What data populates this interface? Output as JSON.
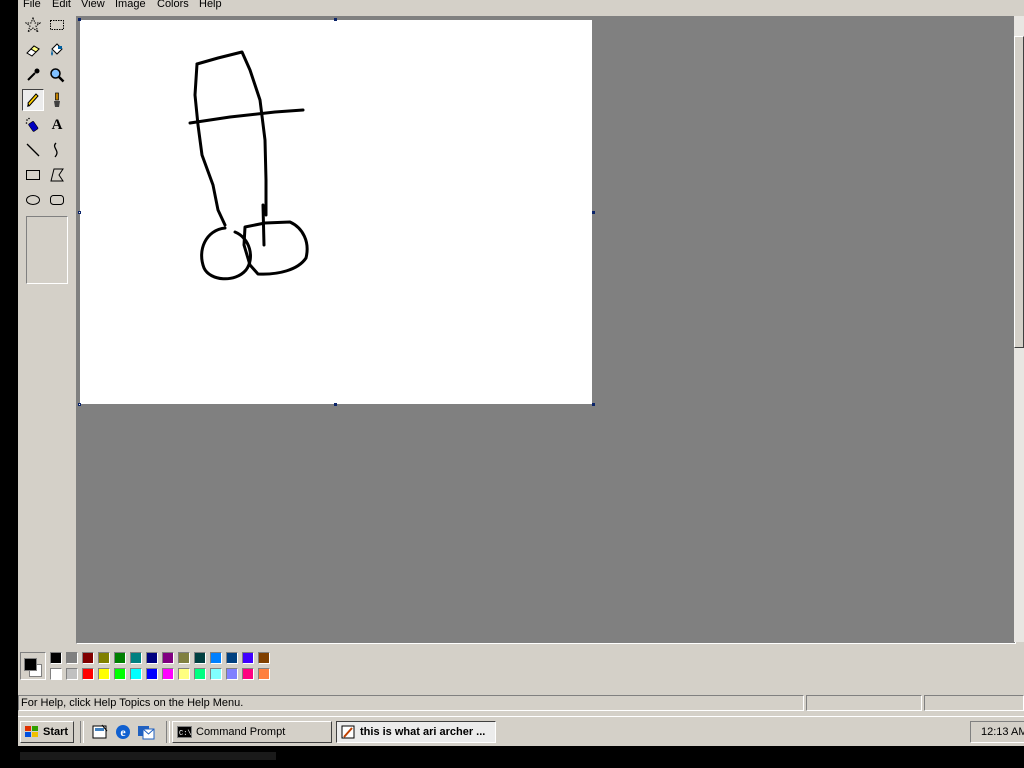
{
  "menu": [
    "File",
    "Edit",
    "View",
    "Image",
    "Colors",
    "Help"
  ],
  "tools": [
    {
      "name": "free-form-select-tool",
      "icon": "star-select-icon"
    },
    {
      "name": "select-tool",
      "icon": "rect-select-icon"
    },
    {
      "name": "eraser-tool",
      "icon": "eraser-icon"
    },
    {
      "name": "fill-tool",
      "icon": "paint-bucket-icon"
    },
    {
      "name": "pick-color-tool",
      "icon": "eyedropper-icon"
    },
    {
      "name": "magnifier-tool",
      "icon": "magnifier-icon"
    },
    {
      "name": "pencil-tool",
      "icon": "pencil-icon",
      "selected": true
    },
    {
      "name": "brush-tool",
      "icon": "brush-icon"
    },
    {
      "name": "airbrush-tool",
      "icon": "airbrush-icon"
    },
    {
      "name": "text-tool",
      "icon": "text-A-icon",
      "glyph": "A"
    },
    {
      "name": "line-tool",
      "icon": "line-icon"
    },
    {
      "name": "curve-tool",
      "icon": "curve-icon"
    },
    {
      "name": "rectangle-tool",
      "icon": "rectangle-icon"
    },
    {
      "name": "polygon-tool",
      "icon": "polygon-icon"
    },
    {
      "name": "ellipse-tool",
      "icon": "ellipse-icon"
    },
    {
      "name": "rounded-rectangle-tool",
      "icon": "rounded-rectangle-icon"
    }
  ],
  "colors": {
    "foreground": "#000000",
    "background": "#ffffff",
    "palette_top": [
      "#000000",
      "#808080",
      "#800000",
      "#808000",
      "#008000",
      "#008080",
      "#000080",
      "#800080",
      "#808040",
      "#004040",
      "#0080ff",
      "#004080",
      "#4000ff",
      "#804000"
    ],
    "palette_bottom": [
      "#ffffff",
      "#c0c0c0",
      "#ff0000",
      "#ffff00",
      "#00ff00",
      "#00ffff",
      "#0000ff",
      "#ff00ff",
      "#ffff80",
      "#00ff80",
      "#80ffff",
      "#8080ff",
      "#ff0080",
      "#ff8040"
    ]
  },
  "statusbar": {
    "help_text": "For Help, click Help Topics on the Help Menu."
  },
  "taskbar": {
    "start_label": "Start",
    "quick_launch": [
      "show-desktop-icon",
      "internet-explorer-icon",
      "outlook-express-icon"
    ],
    "tasks": [
      {
        "label": "Command Prompt",
        "icon": "command-prompt-icon",
        "active": false
      },
      {
        "label": "this is what ari archer ...",
        "icon": "paint-icon",
        "active": true
      }
    ],
    "clock": "12:13 AM"
  }
}
